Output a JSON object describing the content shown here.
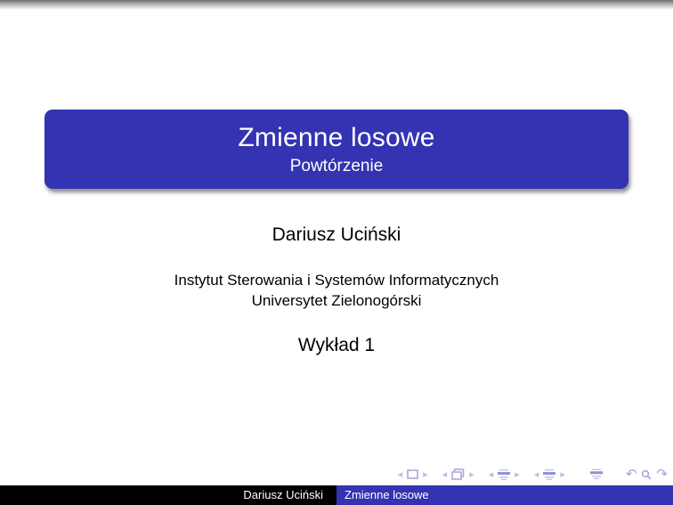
{
  "slide": {
    "title": "Zmienne losowe",
    "subtitle": "Powtórzenie",
    "author": "Dariusz Uciński",
    "institute": [
      "Instytut Sterowania i Systemów Informatycznych",
      "Universytet Zielonogórski"
    ],
    "lecture": "Wykład 1"
  },
  "footer": {
    "author": "Dariusz Uciński",
    "title": "Zmienne losowe"
  },
  "navigation": {
    "symbols": [
      "slide-back",
      "slide",
      "slide-forward",
      "frame-back",
      "frame",
      "frame-forward",
      "subsection-back",
      "subsection",
      "subsection-forward",
      "section-back",
      "section",
      "section-forward",
      "document",
      "history-back",
      "search",
      "history-forward"
    ],
    "back_glyph": "↶",
    "forward_glyph": "↷",
    "arrow_left_glyph": "◂",
    "arrow_right_glyph": "▸"
  },
  "colors": {
    "accent_blue": "#3433b2",
    "footer_black": "#000000",
    "nav_symbol": "#a6a6d8",
    "top_gradient_gray": "#6f6f6f"
  }
}
